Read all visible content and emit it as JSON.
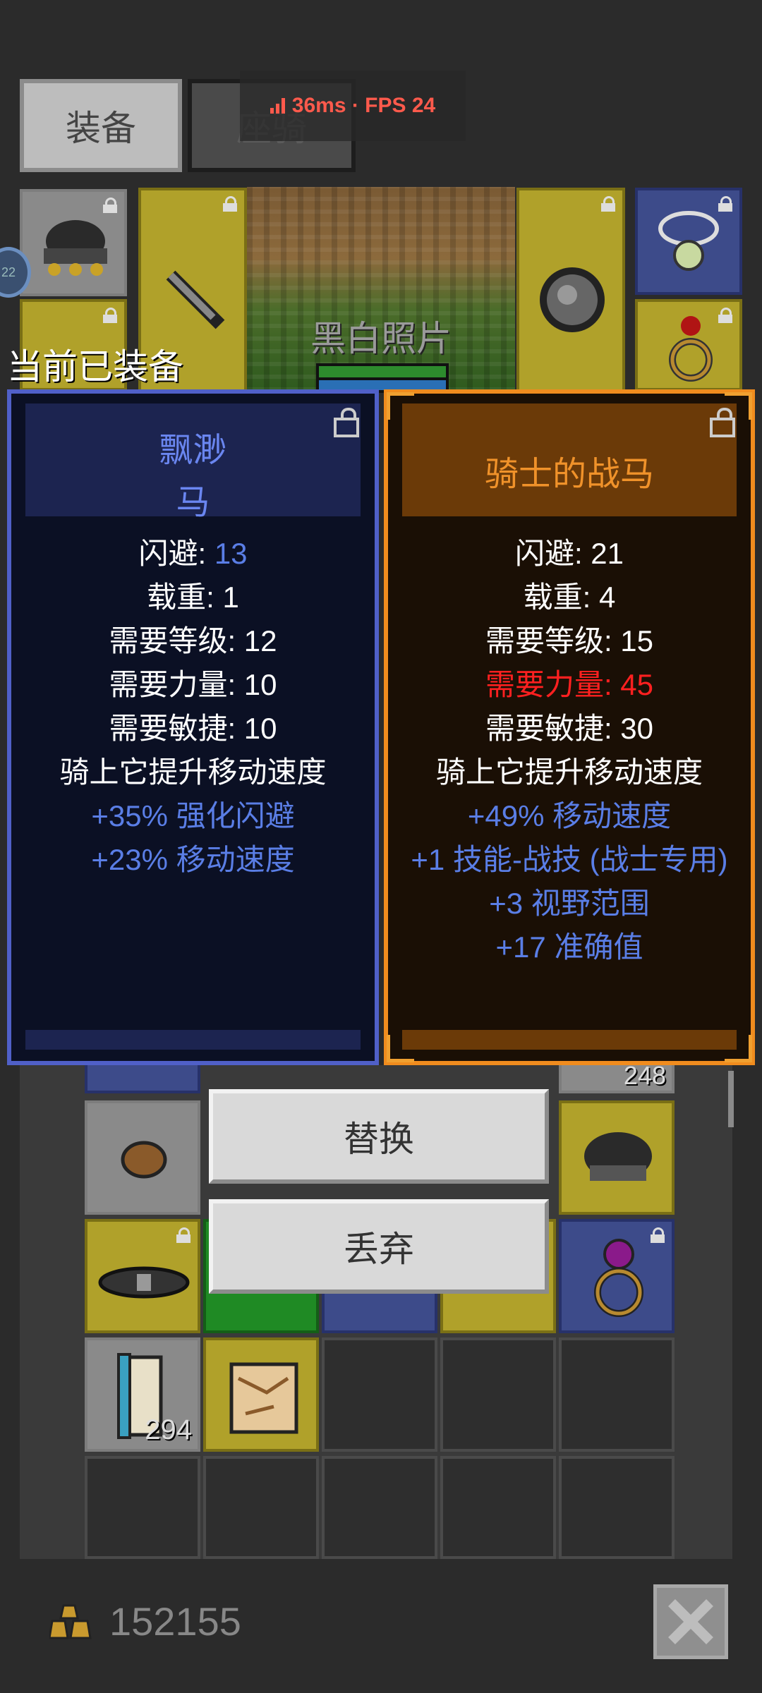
{
  "tabs": {
    "equip": "装备",
    "mount": "座骑"
  },
  "fps": {
    "text": "36ms · FPS 24",
    "color": "#ff5a4c"
  },
  "character": {
    "name": "黑白照片"
  },
  "avatar_badge": "22",
  "equipped_label": "当前已装备",
  "current_item": {
    "title_line1": "飘渺",
    "title_line2": "马",
    "stats": [
      {
        "label": "闪避: ",
        "value": "13"
      },
      {
        "text": "载重: 1"
      },
      {
        "text": "需要等级: 12"
      },
      {
        "text": "需要力量: 10"
      },
      {
        "text": "需要敏捷: 10"
      },
      {
        "text": "骑上它提升移动速度"
      },
      {
        "text": "+35% 强化闪避"
      },
      {
        "text": "+23% 移动速度"
      }
    ]
  },
  "new_item": {
    "title": "骑士的战马",
    "stats": [
      {
        "text": "闪避: 21"
      },
      {
        "text": "载重: 4"
      },
      {
        "text": "需要等级: 15"
      },
      {
        "text": "需要力量: 45"
      },
      {
        "text": "需要敏捷: 30"
      },
      {
        "text": "骑上它提升移动速度"
      },
      {
        "text": "+49% 移动速度"
      },
      {
        "text": "+1 技能-战技 (战士专用)"
      },
      {
        "text": "+3 视野范围"
      },
      {
        "text": "+17 准确值"
      }
    ]
  },
  "inventory": {
    "partial_count": "248",
    "scroll_count": "294"
  },
  "buttons": {
    "replace": "替换",
    "discard": "丢弃"
  },
  "gold": "152155",
  "colors": {
    "left_border": "#5060c8",
    "right_border": "#f08c1e",
    "title_left": "#6a86f0",
    "title_right": "#f0922a",
    "affix": "#5a7ee6",
    "unmet": "#ff2020"
  }
}
